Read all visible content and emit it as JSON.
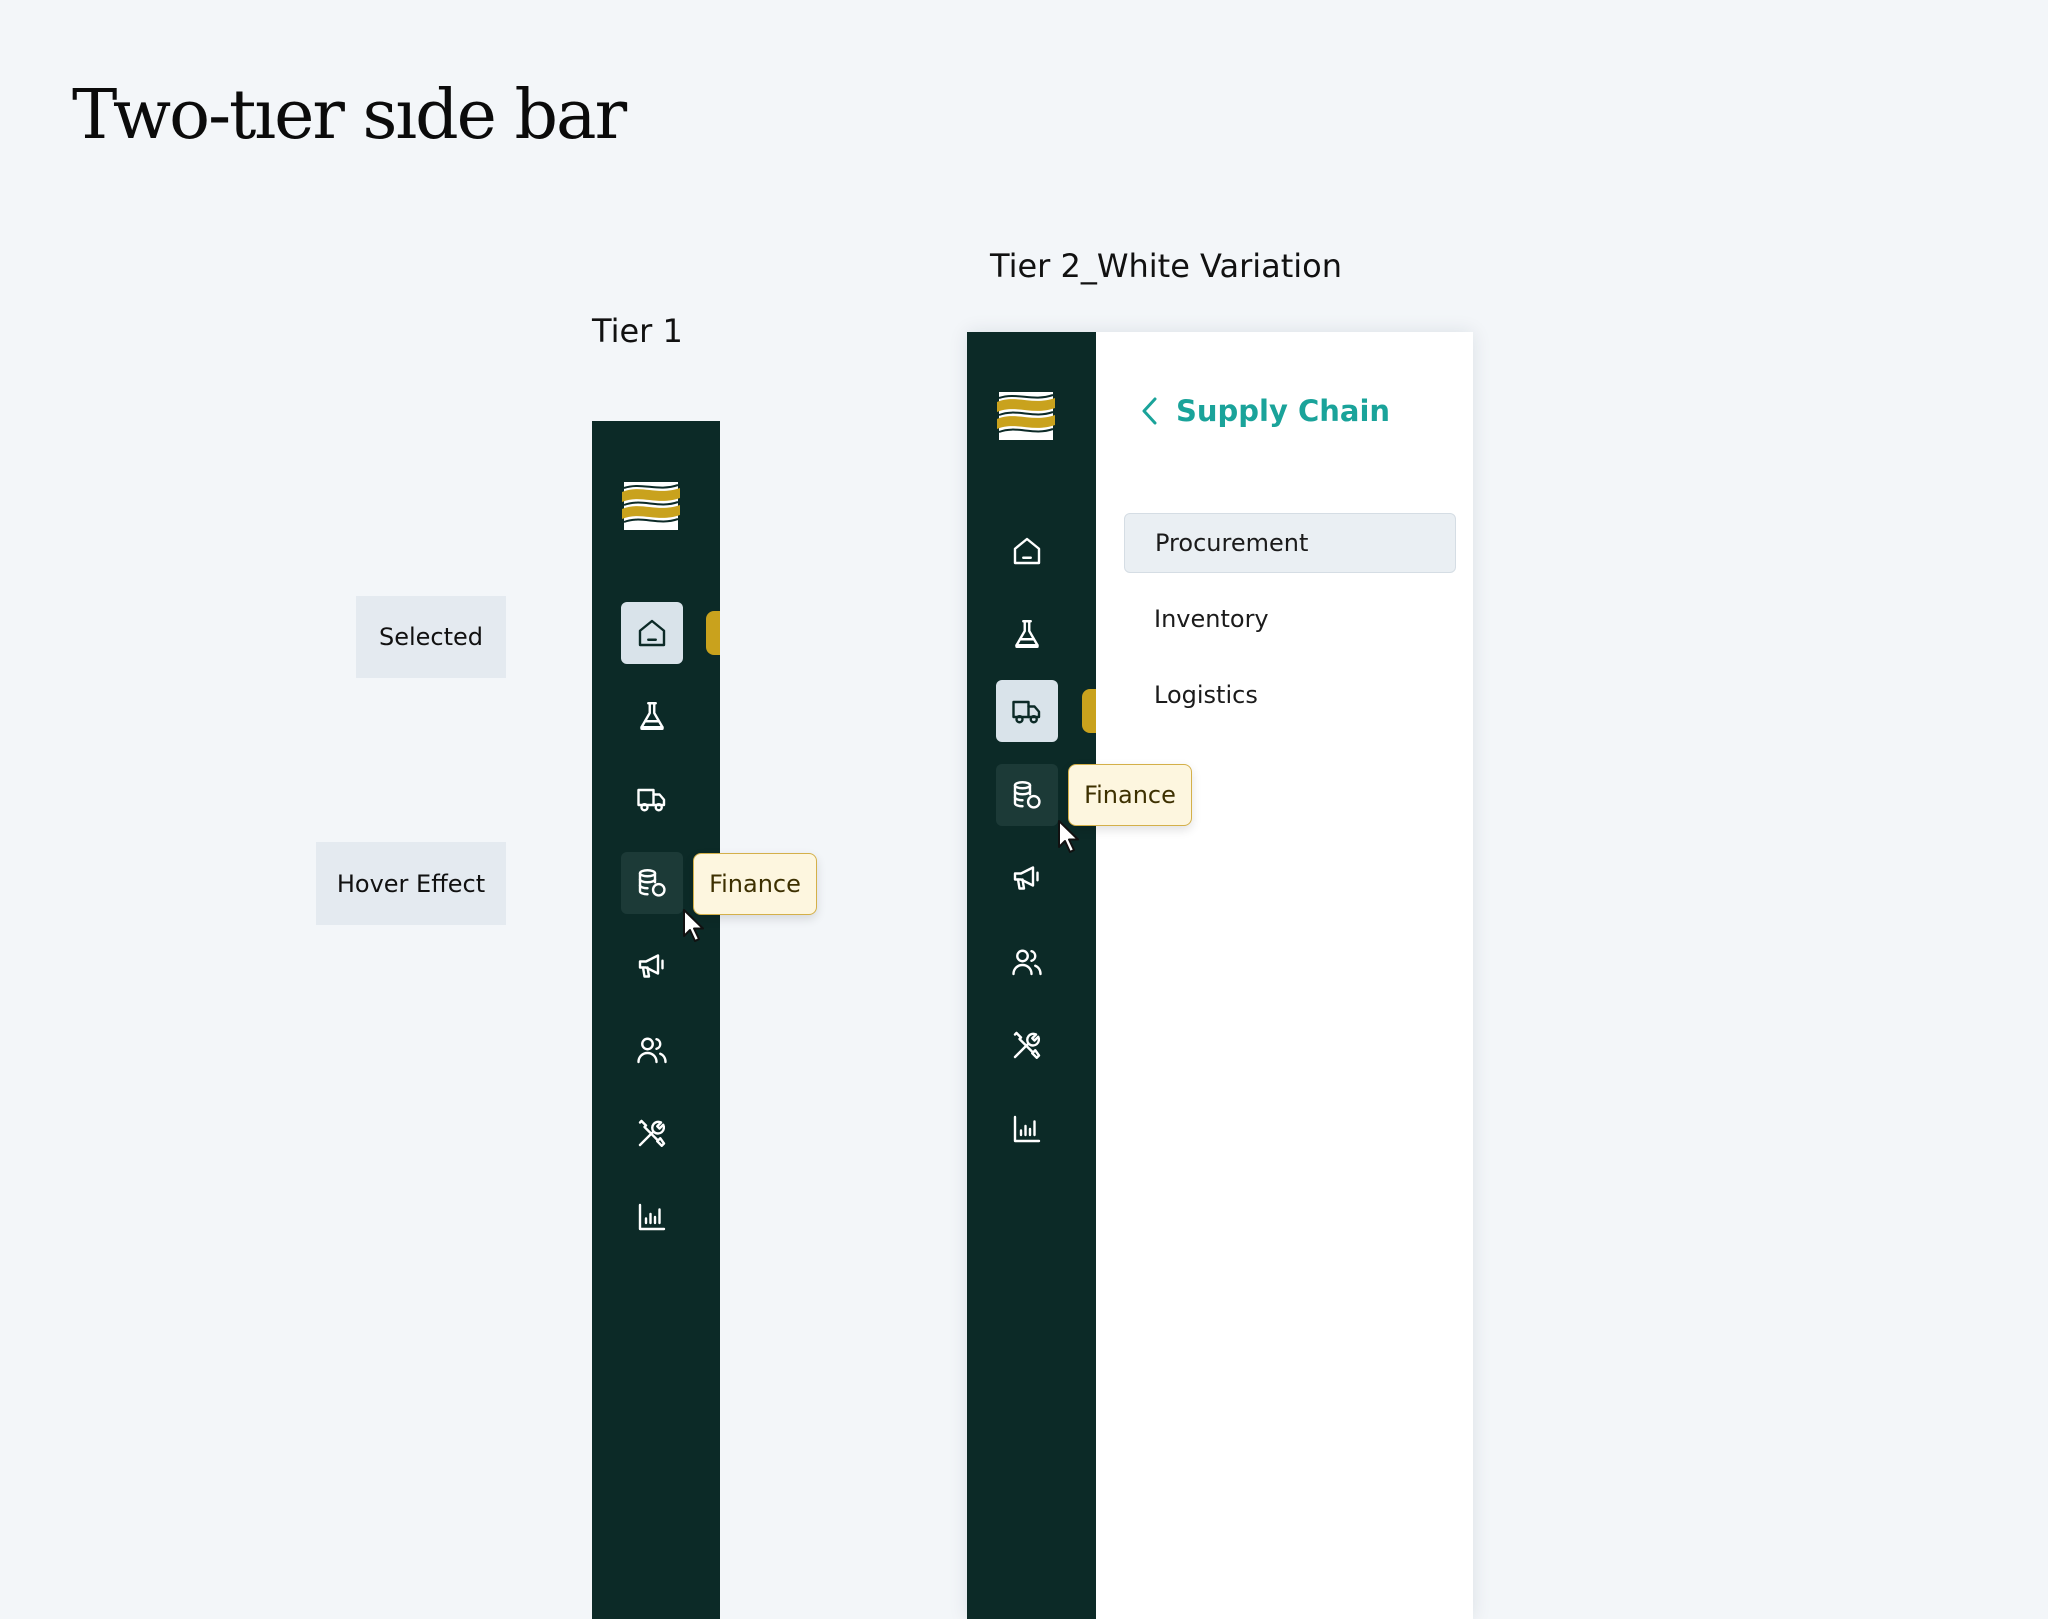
{
  "page": {
    "title": "Two-tıer sıde bar"
  },
  "tier1": {
    "title": "Tier 1",
    "labels": {
      "selected": "Selected",
      "hover": "Hover Effect"
    },
    "tooltip": "Finance",
    "nav_icons": [
      "home-icon",
      "flask-icon",
      "truck-icon",
      "database-coin-icon",
      "megaphone-icon",
      "users-icon",
      "tools-icon",
      "bar-chart-icon"
    ],
    "selected_item": "home-icon",
    "hovered_item": "database-coin-icon"
  },
  "tier2": {
    "title": "Tier 2_White Variation",
    "tooltip": "Finance",
    "selected_item": "truck-icon",
    "hovered_item": "database-coin-icon",
    "back_label": "Supply Chain",
    "items": [
      "Procurement",
      "Inventory",
      "Logistics"
    ],
    "active_item": "Procurement"
  },
  "colors": {
    "background": "#f3f6f9",
    "rail": "#0c2a27",
    "accent_gold": "#c9a21d",
    "accent_teal": "#1aa39a",
    "tooltip_bg": "#fdf6df",
    "selected_bg": "#d9e3ea"
  }
}
